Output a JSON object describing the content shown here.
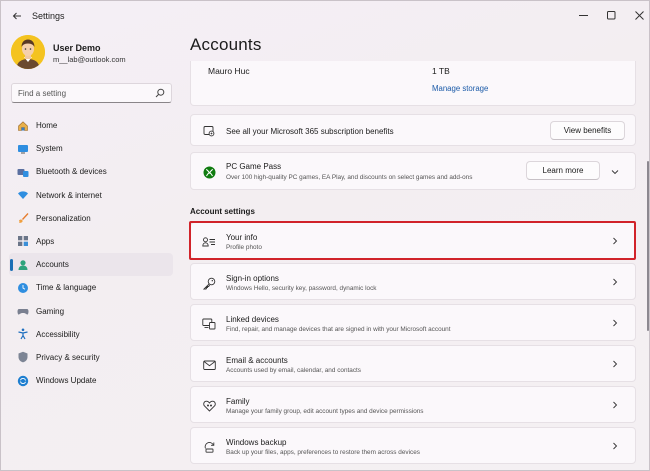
{
  "window": {
    "title": "Settings"
  },
  "profile": {
    "name": "User Demo",
    "email": "m__lab@outlook.com"
  },
  "search": {
    "placeholder": "Find a setting"
  },
  "nav": {
    "items": [
      {
        "label": "Home",
        "icon": "home-icon"
      },
      {
        "label": "System",
        "icon": "system-icon"
      },
      {
        "label": "Bluetooth & devices",
        "icon": "bluetooth-icon"
      },
      {
        "label": "Network & internet",
        "icon": "network-icon"
      },
      {
        "label": "Personalization",
        "icon": "brush-icon"
      },
      {
        "label": "Apps",
        "icon": "apps-icon"
      },
      {
        "label": "Accounts",
        "icon": "accounts-icon",
        "active": true
      },
      {
        "label": "Time & language",
        "icon": "globe-clock-icon"
      },
      {
        "label": "Gaming",
        "icon": "gamepad-icon"
      },
      {
        "label": "Accessibility",
        "icon": "accessibility-icon"
      },
      {
        "label": "Privacy & security",
        "icon": "shield-icon"
      },
      {
        "label": "Windows Update",
        "icon": "update-icon"
      }
    ]
  },
  "main": {
    "title": "Accounts",
    "storage": {
      "name": "Mauro Huc",
      "size": "1 TB",
      "link": "Manage storage"
    },
    "m365": {
      "text": "See all your Microsoft 365 subscription benefits",
      "button": "View benefits"
    },
    "gamepass": {
      "title": "PC Game Pass",
      "subtitle": "Over 100 high-quality PC games, EA Play, and discounts on select games and add-ons",
      "button": "Learn more"
    },
    "section_title": "Account settings",
    "settings": [
      {
        "title": "Your info",
        "subtitle": "Profile photo",
        "icon": "user-info-icon"
      },
      {
        "title": "Sign-in options",
        "subtitle": "Windows Hello, security key, password, dynamic lock",
        "icon": "key-icon"
      },
      {
        "title": "Linked devices",
        "subtitle": "Find, repair, and manage devices that are signed in with your Microsoft account",
        "icon": "linked-devices-icon"
      },
      {
        "title": "Email & accounts",
        "subtitle": "Accounts used by email, calendar, and contacts",
        "icon": "mail-icon"
      },
      {
        "title": "Family",
        "subtitle": "Manage your family group, edit account types and device permissions",
        "icon": "family-heart-icon"
      },
      {
        "title": "Windows backup",
        "subtitle": "Back up your files, apps, preferences to restore them across devices",
        "icon": "backup-icon"
      }
    ]
  },
  "colors": {
    "accent": "#1a6fb5",
    "highlight": "#d1232a",
    "link": "#1a5aa8"
  }
}
